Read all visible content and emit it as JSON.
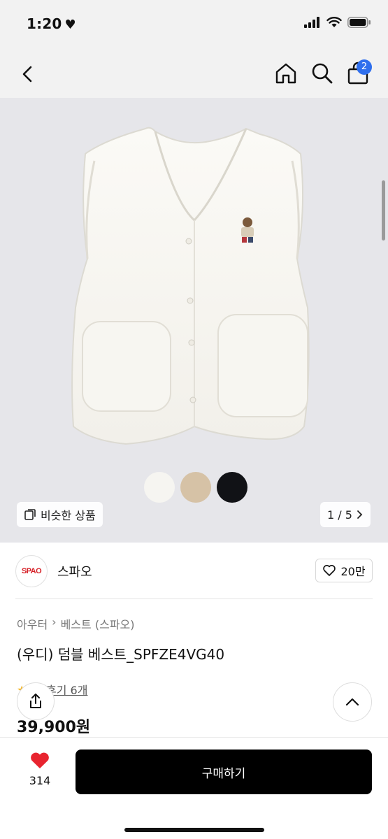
{
  "status_bar": {
    "time": "1:20",
    "heart": "♥"
  },
  "nav": {
    "cart_count": "2"
  },
  "hero": {
    "swatches": [
      "#f6f5f1",
      "#d6c2a6",
      "#111216"
    ],
    "similar_label": "비슷한 상품",
    "page_indicator": "1 / 5"
  },
  "brand": {
    "logo_text": "SPAO",
    "name": "스파오",
    "like_count": "20만"
  },
  "product": {
    "breadcrumb": [
      "아우터",
      "베스트 (스파오)"
    ],
    "title": "(우디) 덤블 베스트_SPFZE4VG40",
    "review_link": "후기 6개",
    "price": "39,900원"
  },
  "bottom": {
    "wish_count": "314",
    "buy_label": "구매하기"
  },
  "colors": {
    "accent": "#2f6fed",
    "wish_heart": "#e8242f",
    "buy_bg": "#000000"
  }
}
